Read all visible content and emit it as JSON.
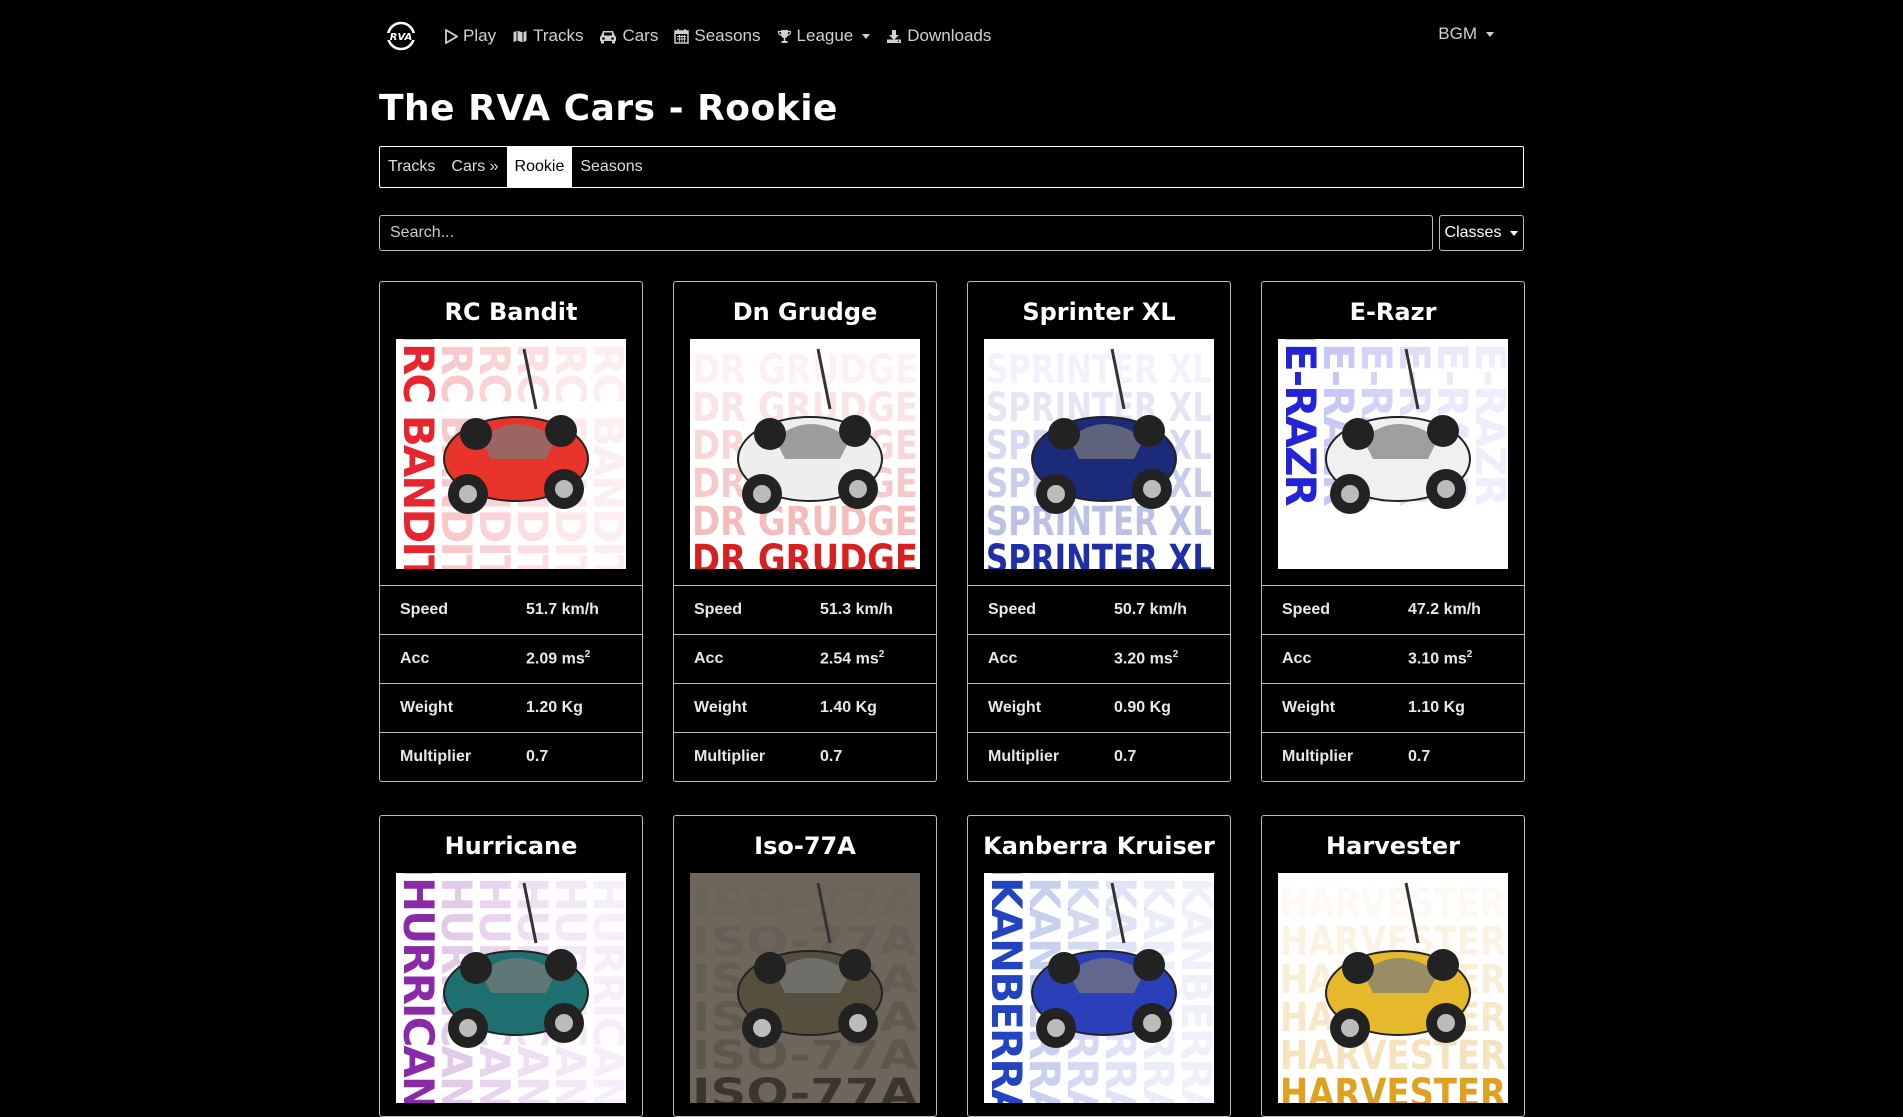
{
  "nav": {
    "items": [
      {
        "label": "Play",
        "icon": "play-icon"
      },
      {
        "label": "Tracks",
        "icon": "map-icon"
      },
      {
        "label": "Cars",
        "icon": "car-icon"
      },
      {
        "label": "Seasons",
        "icon": "calendar-icon"
      },
      {
        "label": "League",
        "icon": "trophy-icon",
        "dropdown": true
      },
      {
        "label": "Downloads",
        "icon": "download-icon"
      }
    ],
    "bgm_label": "BGM"
  },
  "page": {
    "title": "The RVA Cars - Rookie"
  },
  "tabs": [
    {
      "label": "Tracks"
    },
    {
      "label": "Cars »"
    },
    {
      "label": "Rookie",
      "active": true
    },
    {
      "label": "Seasons"
    }
  ],
  "search": {
    "placeholder": "Search...",
    "value": ""
  },
  "classes_label": "Classes",
  "stat_labels": {
    "speed": "Speed",
    "acc": "Acc",
    "weight": "Weight",
    "multiplier": "Multiplier",
    "acc_unit_sup": "2"
  },
  "cars": [
    {
      "name": "RC Bandit",
      "speed": "51.7 km/h",
      "acc": "2.09 ms",
      "weight": "1.20 Kg",
      "multiplier": "0.7",
      "banner": "RC BANDIT",
      "color": "#e8242f"
    },
    {
      "name": "Dn Grudge",
      "speed": "51.3 km/h",
      "acc": "2.54 ms",
      "weight": "1.40 Kg",
      "multiplier": "0.7",
      "banner": "DR GRUDGE",
      "color": "#d92020"
    },
    {
      "name": "Sprinter XL",
      "speed": "50.7 km/h",
      "acc": "3.20 ms",
      "weight": "0.90 Kg",
      "multiplier": "0.7",
      "banner": "SPRINTER XL",
      "color": "#1e2fa8"
    },
    {
      "name": "E-Razr",
      "speed": "47.2 km/h",
      "acc": "3.10 ms",
      "weight": "1.10 Kg",
      "multiplier": "0.7",
      "banner": "E-RAZR",
      "color": "#2323d8"
    },
    {
      "name": "Hurricane",
      "banner": "HURRICANE",
      "color": "#8a2aa8"
    },
    {
      "name": "Iso-77A",
      "banner": "ISO-77A",
      "color": "#3a3530"
    },
    {
      "name": "Kanberra Kruiser",
      "banner": "KANBERRA",
      "color": "#2344c0"
    },
    {
      "name": "Harvester",
      "banner": "HARVESTER",
      "color": "#e0a020"
    }
  ]
}
